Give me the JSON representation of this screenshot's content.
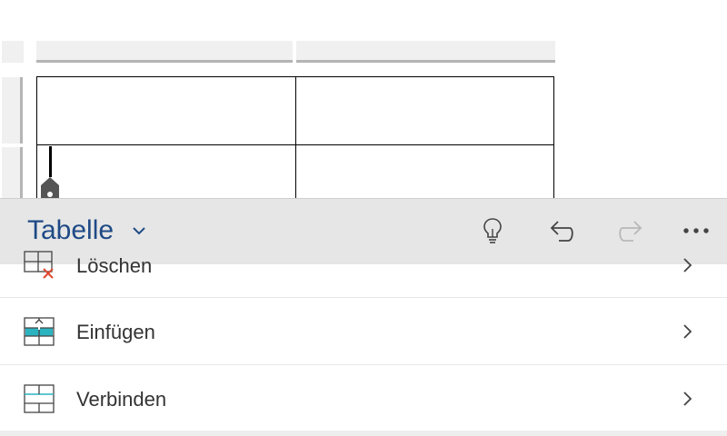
{
  "toolbar": {
    "title": "Tabelle",
    "icons": [
      "chevron-down-icon",
      "lightbulb-icon",
      "undo-icon",
      "redo-icon",
      "more-icon"
    ]
  },
  "list": {
    "items": [
      {
        "label": "Löschen",
        "icon": "delete-table-icon"
      },
      {
        "label": "Einfügen",
        "icon": "insert-table-icon"
      },
      {
        "label": "Verbinden",
        "icon": "merge-cells-icon"
      }
    ]
  },
  "colors": {
    "accent": "#1f4a86",
    "toolbar_bg": "#e6e6e6",
    "insert_teal": "#2bb3c0",
    "delete_red": "#e04a2f"
  }
}
